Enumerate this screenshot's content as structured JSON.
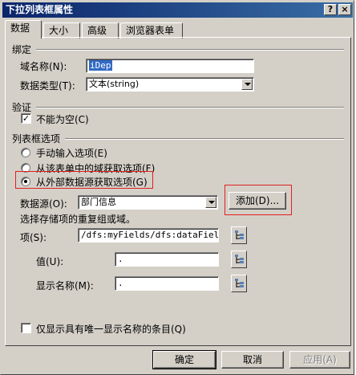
{
  "window": {
    "title": "下拉列表框属性",
    "help_label": "?",
    "close_label": "×"
  },
  "tabs": [
    {
      "label": "数据"
    },
    {
      "label": "大小"
    },
    {
      "label": "高级"
    },
    {
      "label": "浏览器表单"
    }
  ],
  "binding": {
    "section": "绑定",
    "field_name_label": "域名称(N):",
    "field_name_value": "iDep",
    "data_type_label": "数据类型(T):",
    "data_type_value": "文本(string)"
  },
  "validation": {
    "section": "验证",
    "not_empty_label": "不能为空(C)",
    "not_empty_checked": "✓"
  },
  "list_options": {
    "section": "列表框选项",
    "radio_manual": "手动输入选项(E)",
    "radio_from_form": "从该表单中的域获取选项(F)",
    "radio_external": "从外部数据源获取选项(G)",
    "datasource_label": "数据源(O):",
    "datasource_value": "部门信息",
    "add_button": "添加(D)...",
    "repeat_group_hint": "选择存储项的重复组或域。",
    "item_label": "项(S):",
    "item_value": "/dfs:myFields/dfs:dataFields/",
    "value_label": "值(U):",
    "value_value": ".",
    "display_name_label": "显示名称(M):",
    "display_name_value": ".",
    "unique_only_label": "仅显示具有唯一显示名称的条目(Q)"
  },
  "footer": {
    "ok": "确定",
    "cancel": "取消",
    "apply": "应用(A)"
  },
  "colors": {
    "title_bar_start": "#0a246a",
    "title_bar_end": "#3a6ea5",
    "dialog_face": "#d4d0c8",
    "highlight_box": "#e02020"
  }
}
